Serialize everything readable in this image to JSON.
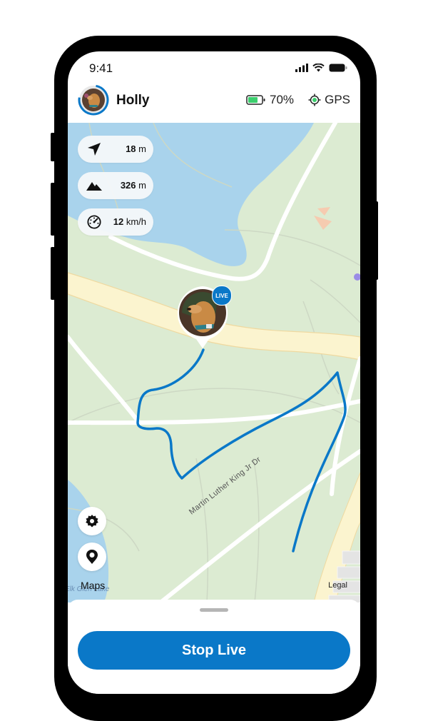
{
  "status_bar": {
    "time": "9:41",
    "icons": [
      "cellular-signal-icon",
      "wifi-icon",
      "battery-icon"
    ]
  },
  "header": {
    "pet_name": "Holly",
    "tracker_battery_percent": "70%",
    "tracker_battery_level": 0.7,
    "gps_label": "GPS",
    "colors": {
      "battery_fill": "#3ccf6e",
      "gps_dot": "#3ccf6e",
      "avatar_ring": "#0a78c8"
    }
  },
  "stats": [
    {
      "icon": "navigation-arrow-icon",
      "value": "18",
      "unit": "m"
    },
    {
      "icon": "mountains-icon",
      "value": "326",
      "unit": "m"
    },
    {
      "icon": "speedometer-icon",
      "value": "12",
      "unit": "km/h"
    }
  ],
  "map": {
    "marker_badge": "LIVE",
    "road_label": "Martin Luther King Jr Dr",
    "lake_label": "Elk Glen Lake",
    "maps_attribution": "Maps",
    "legal_link": "Legal",
    "track_color": "#0a78c8"
  },
  "map_controls": [
    {
      "icon": "gear-icon",
      "label": "Settings"
    },
    {
      "icon": "location-pin-icon",
      "label": "Location"
    }
  ],
  "sheet": {
    "primary_button": "Stop Live",
    "accent_color": "#0a78c8"
  }
}
